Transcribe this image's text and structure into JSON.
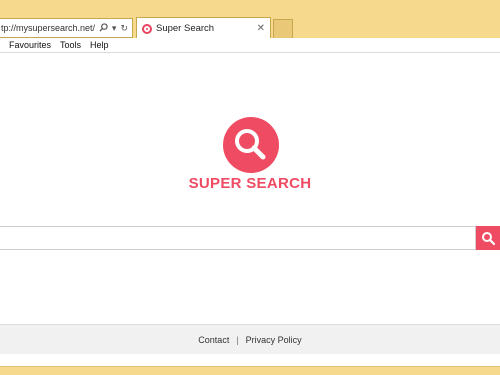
{
  "browser": {
    "address": "tp://mysupersearch.net/",
    "tab_title": "Super Search",
    "address_controls": [
      "search-icon",
      "dropdown-icon",
      "refresh-icon"
    ],
    "accent": "#f6d98d"
  },
  "menu": {
    "items": [
      "Favourites",
      "Tools",
      "Help"
    ]
  },
  "page": {
    "brand": "SUPER SEARCH",
    "brand_color": "#ef4c63",
    "search_placeholder": ""
  },
  "footer": {
    "contact": "Contact",
    "separator": "|",
    "privacy": "Privacy Policy"
  }
}
